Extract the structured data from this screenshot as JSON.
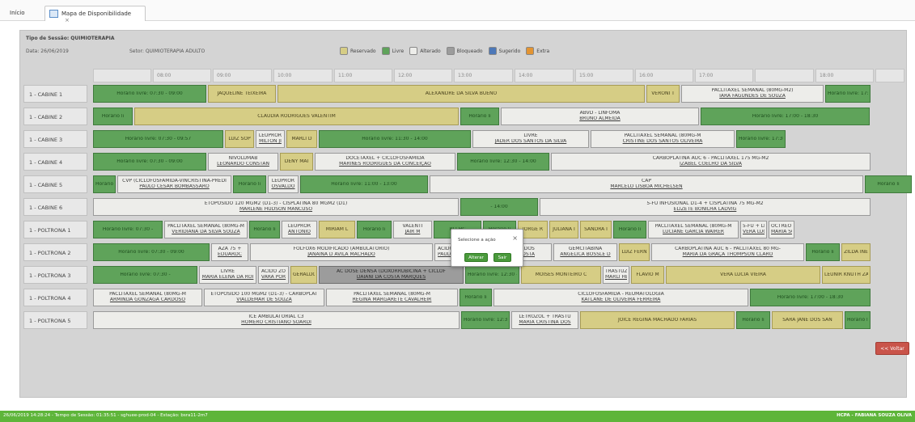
{
  "tabs": {
    "home": "Início",
    "map": "Mapa de Disponibilidade",
    "map_close": "×"
  },
  "session": {
    "title": "Tipo de Sessão: QUIMIOTERAPIA",
    "date": "Data: 26/06/2019",
    "sector": "Setor: QUIMIOTERAPIA ADULTO"
  },
  "legend": [
    {
      "label": "Reservado",
      "color": "#d6cd85"
    },
    {
      "label": "Livre",
      "color": "#5fa35a"
    },
    {
      "label": "Alterado",
      "color": "#ededea"
    },
    {
      "label": "Bloqueado",
      "color": "#9c9c9c"
    },
    {
      "label": "Sugerido",
      "color": "#4d78b8"
    },
    {
      "label": "Extra",
      "color": "#e39432"
    }
  ],
  "times": [
    "08:00",
    "09:00",
    "10:00",
    "11:00",
    "12:00",
    "13:00",
    "14:00",
    "15:00",
    "16:00",
    "17:00",
    "18:00"
  ],
  "rows": [
    {
      "label": "1 - CABINE 1",
      "cells": [
        {
          "s": "livre",
          "t1": "Horário livre: 07:30 - 09:00"
        },
        {
          "s": "reservado",
          "t1": "JAQUELINE TEIXEIRA"
        },
        {
          "s": "reservado",
          "t1": "ALEXANDRE DA SILVA BUENO"
        },
        {
          "s": "reservado",
          "t1": "VERONI T"
        },
        {
          "s": "alterado",
          "t1": "PACLITAXEL SEMANAL (80MG-M2)",
          "t2": "IARA FAGUNDES DE SOUZA"
        },
        {
          "s": "livre",
          "t1": "Horário livre: 17:30 -"
        }
      ]
    },
    {
      "label": "1 - CABINE 2",
      "cells": [
        {
          "s": "livre",
          "t1": "Horário li"
        },
        {
          "s": "reservado",
          "t1": "CLAUDIA RODRIGUES VALENTIM"
        },
        {
          "s": "livre",
          "t1": "Horário li"
        },
        {
          "s": "alterado",
          "t1": "ABVD - LINFOMA",
          "t2": "BRUNO ALMEIDA"
        },
        {
          "s": "livre",
          "t1": "Horário livre: 17:00 - 18:30"
        }
      ]
    },
    {
      "label": "1 - CABINE 3",
      "cells": [
        {
          "s": "livre",
          "t1": "Horário livre: 07:30 - 09:57"
        },
        {
          "s": "reservado",
          "t1": "LUIZ SOP"
        },
        {
          "s": "alterado",
          "t1": "LEUPROR",
          "t2": "MILTON JI"
        },
        {
          "s": "reservado",
          "t1": "MARLI D"
        },
        {
          "s": "livre",
          "t1": "Horário livre: 11:30 - 14:00"
        },
        {
          "s": "alterado",
          "t1": "LIVRE",
          "t2": "JADER DOS SANTOS DA SILVA"
        },
        {
          "s": "alterado",
          "t1": "PACLITAXEL SEMANAL (80MG-M",
          "t2": "CRISTINE DOS SANTOS OLIVEIRA"
        },
        {
          "s": "livre",
          "t1": "Horário livre: 17:30 -"
        }
      ]
    },
    {
      "label": "1 - CABINE 4",
      "cells": [
        {
          "s": "livre",
          "t1": "Horário livre: 07:30 - 09:00"
        },
        {
          "s": "alterado",
          "t1": "NIVOLUMAB",
          "t2": "LEONARDO CONSTAN"
        },
        {
          "s": "reservado",
          "t1": "DENY MAI"
        },
        {
          "s": "alterado",
          "t1": "DOCETAXEL + CICLOFOSFAMIDA",
          "t2": "MARINES RODRIGUES DA CONCEIÇÃO"
        },
        {
          "s": "livre",
          "t1": "Horário livre: 12:30 - 14:00"
        },
        {
          "s": "alterado",
          "t1": "CARBOPLATINA AUC 6 - PACLITAXEL 175 MG-M2",
          "t2": "IZABEL COELHO DA SILVA"
        }
      ]
    },
    {
      "label": "1 - CABINE 5",
      "cells": [
        {
          "s": "livre",
          "t1": "Horário li"
        },
        {
          "s": "alterado",
          "t1": "CVP (CICLOFOSFAMIDA-VINCRISTINA-PREDI",
          "t2": "PAULO CESAR BOMBASSARO"
        },
        {
          "s": "livre",
          "t1": "Horário li"
        },
        {
          "s": "alterado",
          "t1": "LEUPROR",
          "t2": "OSVALDO"
        },
        {
          "s": "livre",
          "t1": "Horário livre: 11:00 - 13:00"
        },
        {
          "s": "alterado",
          "t1": "CAP",
          "t2": "MARCELO LISBOA MICHELSEN"
        },
        {
          "s": "livre",
          "t1": "Horário li"
        }
      ]
    },
    {
      "label": "1 - CABINE 6",
      "cells": [
        {
          "s": "alterado",
          "t1": "ETOPOSIDO 120 MGM2 (D1-3) - CISPLATINA 80 MGM2 (D1)",
          "t2": "MARLENE HUDSON MANCUSO"
        },
        {
          "s": "livre",
          "t1": "- 14:00"
        },
        {
          "s": "alterado",
          "t1": "5-FU INFUSIONAL D1-4 + CISPLATINA 75 MG-M2",
          "t2": "ELIZETE BONILHA LADVIG"
        }
      ]
    },
    {
      "label": "1 - POLTRONA 1",
      "cells": [
        {
          "s": "livre",
          "t1": "Horário livre: 07:30 -"
        },
        {
          "s": "alterado",
          "t1": "PACLITAXEL SEMANAL (80MG-M",
          "t2": "VERIDIANA DA SILVA SOUZA"
        },
        {
          "s": "livre",
          "t1": "Horário li"
        },
        {
          "s": "alterado",
          "t1": "LEUPROR",
          "t2": "ANTONIO"
        },
        {
          "s": "reservado",
          "t1": "MIRIAM L"
        },
        {
          "s": "livre",
          "t1": "Horário li"
        },
        {
          "s": "alterado",
          "t1": "VALENTI",
          "t2": "JAIR M"
        },
        {
          "s": "livre",
          "t1": "RLI HC"
        },
        {
          "s": "livre",
          "t1": "Horário li"
        },
        {
          "s": "reservado",
          "t1": "JORGE R"
        },
        {
          "s": "reservado",
          "t1": "JULIANA I"
        },
        {
          "s": "reservado",
          "t1": "SANDRA I"
        },
        {
          "s": "livre",
          "t1": "Horário li"
        },
        {
          "s": "alterado",
          "t1": "PACLITAXEL SEMANAL (80MG-M",
          "t2": "LUCIANE GARCIA WAIRER"
        },
        {
          "s": "alterado",
          "t1": "5-FU + LEI",
          "t2": "VERA LUC"
        },
        {
          "s": "alterado",
          "t1": "OCTREOT",
          "t2": "MARIA SC"
        }
      ]
    },
    {
      "label": "1 - POLTRONA 2",
      "cells": [
        {
          "s": "livre",
          "t1": "Horário livre: 07:30 - 09:00"
        },
        {
          "s": "alterado",
          "t1": "AZA 75 +",
          "t2": "EDUARDC"
        },
        {
          "s": "alterado",
          "t1": "FOLFOX6 MODIFICADO (AMBULATORIO)",
          "t2": "JANAINA D AVILA MACHADO"
        },
        {
          "s": "alterado",
          "t1": "ACIDO ZO",
          "t2": "PAULO DE"
        },
        {
          "s": "alterado",
          "t1": "TRASTUZUMAB (DOS",
          "t2": "ADALGISA DA COSTA"
        },
        {
          "s": "alterado",
          "t1": "GEMCITABINA",
          "t2": "ANGELICA BOSSLE D"
        },
        {
          "s": "reservado",
          "t1": "LUIZ FERN"
        },
        {
          "s": "alterado",
          "t1": "CARBOPLATINA AUC 6 - PACLITAXEL 80 MG-",
          "t2": "MARIA DA GRAÇA THOMPSON CLARO"
        },
        {
          "s": "livre",
          "t1": "Horário li"
        },
        {
          "s": "reservado",
          "t1": "ZILDA INE"
        }
      ]
    },
    {
      "label": "1 - POLTRONA 3",
      "cells": [
        {
          "s": "livre",
          "t1": "Horário livre: 07:30 -"
        },
        {
          "s": "alterado",
          "t1": "LIVRE",
          "t2": "MARIA ELENA DA ROI"
        },
        {
          "s": "alterado",
          "t1": "ACIDO ZO",
          "t2": "VARA POR"
        },
        {
          "s": "reservado",
          "t1": "GERALDO"
        },
        {
          "s": "bloqueado",
          "t1": "AC DOSE DENSA (DOXORRUBICINA + CICLOF",
          "t2": "DAIANI DA COSTA MARQUES"
        },
        {
          "s": "livre",
          "t1": "Horário livre: 12:30 -"
        },
        {
          "s": "reservado",
          "t1": "MOISES MONTEIRO C"
        },
        {
          "s": "alterado",
          "t1": "TRASTUZI",
          "t2": "MARLI HE"
        },
        {
          "s": "reservado",
          "t1": "FLAVIO M"
        },
        {
          "s": "reservado",
          "t1": "VERA LUCIA VIEIRA"
        },
        {
          "s": "reservado",
          "t1": "LEUNIR KNUTH ZACH"
        }
      ]
    },
    {
      "label": "1 - POLTRONA 4",
      "cells": [
        {
          "s": "alterado",
          "t1": "PACLITAXEL SEMANAL (80MG-M",
          "t2": "ARMINDA GONZAGA CARDOSO"
        },
        {
          "s": "alterado",
          "t1": "ETOPOSIDO 100 MGM2 (D1-3) - CARBOPLAT",
          "t2": "VIALDEMAR DE SOUZA"
        },
        {
          "s": "alterado",
          "t1": "PACLITAXEL SEMANAL (80MG-M",
          "t2": "REGINA MARGARETE CAVALHEIR"
        },
        {
          "s": "livre",
          "t1": "Horário li"
        },
        {
          "s": "alterado",
          "t1": "CICLOFOSFAMIDA - REUMATOLOGIA",
          "t2": "KATLANE DE OLIVEIRA FERREIRA"
        },
        {
          "s": "livre",
          "t1": "Horário livre: 17:00 - 18:30"
        }
      ]
    },
    {
      "label": "1 - POLTRONA 5",
      "cells": [
        {
          "s": "alterado",
          "t1": "ICE AMBULATORIAL C3",
          "t2": "HOMERO CRISTIANO SOARDI"
        },
        {
          "s": "livre",
          "t1": "Horário livre: 12:30 -"
        },
        {
          "s": "alterado",
          "t1": "LETROZOL + TRASTU",
          "t2": "MARIA CRISTINA DOS"
        },
        {
          "s": "reservado",
          "t1": "JOICE REGINA MACHADO FARIAS"
        },
        {
          "s": "livre",
          "t1": "Horário li"
        },
        {
          "s": "reservado",
          "t1": "SARA JANE DOS SAN"
        },
        {
          "s": "livre",
          "t1": "Horário li"
        }
      ]
    }
  ],
  "modal": {
    "title": "Selecione a ação",
    "close": "×",
    "alterar": "Alterar",
    "sair": "Sair"
  },
  "back_button": "<< Voltar",
  "status": {
    "left": "26/06/2019 14:28:24 - Tempo de Sessão: 01:35:51 - sghuee-prod-04 - Estação: bsra11-2m7",
    "right": "HCPA - FABIANA SOUZA OLIVA"
  }
}
